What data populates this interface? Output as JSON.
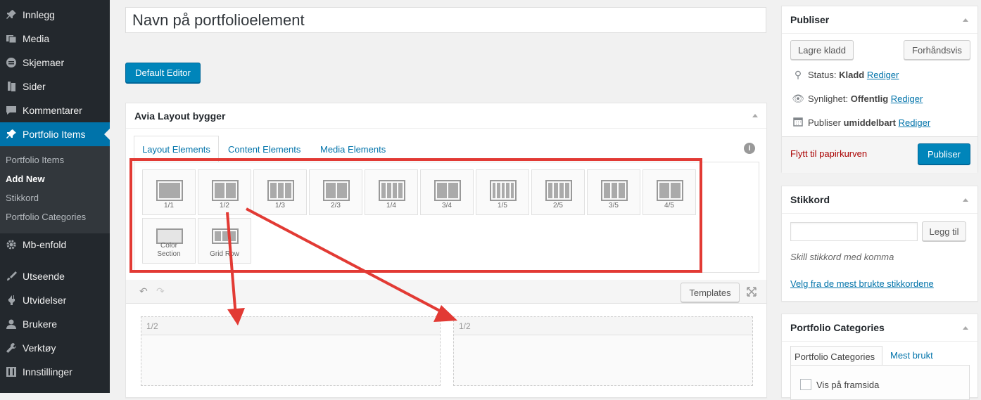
{
  "sidebar": {
    "items": [
      {
        "label": "Innlegg",
        "icon": "pin-icon"
      },
      {
        "label": "Media",
        "icon": "media-icon"
      },
      {
        "label": "Skjemaer",
        "icon": "forms-icon"
      },
      {
        "label": "Sider",
        "icon": "page-icon"
      },
      {
        "label": "Kommentarer",
        "icon": "comment-icon"
      },
      {
        "label": "Portfolio Items",
        "icon": "pin-icon"
      },
      {
        "label": "Mb-enfold",
        "icon": "gear-icon"
      },
      {
        "label": "Utseende",
        "icon": "brush-icon"
      },
      {
        "label": "Utvidelser",
        "icon": "plugin-icon"
      },
      {
        "label": "Brukere",
        "icon": "user-icon"
      },
      {
        "label": "Verktøy",
        "icon": "wrench-icon"
      },
      {
        "label": "Innstillinger",
        "icon": "settings-icon"
      }
    ],
    "submenu": [
      "Portfolio Items",
      "Add New",
      "Stikkord",
      "Portfolio Categories"
    ]
  },
  "editor": {
    "title_value": "Navn på portfolioelement",
    "default_editor_label": "Default Editor"
  },
  "builder": {
    "title": "Avia Layout bygger",
    "tabs": [
      "Layout Elements",
      "Content Elements",
      "Media Elements"
    ],
    "elements": [
      {
        "label": "1/1",
        "cols": 1
      },
      {
        "label": "1/2",
        "cols": 2
      },
      {
        "label": "1/3",
        "cols": 3
      },
      {
        "label": "2/3",
        "cols": 2
      },
      {
        "label": "1/4",
        "cols": 4
      },
      {
        "label": "3/4",
        "cols": 2
      },
      {
        "label": "1/5",
        "cols": 5
      },
      {
        "label": "2/5",
        "cols": 4
      },
      {
        "label": "3/5",
        "cols": 3
      },
      {
        "label": "4/5",
        "cols": 2
      }
    ],
    "elements_row2": [
      {
        "label": "Color Section"
      },
      {
        "label": "Grid Row"
      }
    ],
    "templates_label": "Templates",
    "cells": [
      "1/2",
      "1/2"
    ]
  },
  "publish": {
    "title": "Publiser",
    "save_draft": "Lagre kladd",
    "preview": "Forhåndsvis",
    "status_label": "Status:",
    "status_value": "Kladd",
    "visibility_label": "Synlighet:",
    "visibility_value": "Offentlig",
    "publish_label": "Publiser",
    "publish_value": "umiddelbart",
    "edit_link": "Rediger",
    "trash": "Flytt til papirkurven",
    "publish_button": "Publiser"
  },
  "tags": {
    "title": "Stikkord",
    "add_button": "Legg til",
    "hint": "Skill stikkord med komma",
    "popular_link": "Velg fra de mest brukte stikkordene"
  },
  "categories": {
    "title": "Portfolio Categories",
    "tabs": [
      "Portfolio Categories",
      "Mest brukt"
    ],
    "items": [
      "Vis på framsida"
    ]
  },
  "colors": {
    "sidebar_bg": "#23282d",
    "accent": "#0073aa",
    "annotation": "#e23a34"
  }
}
